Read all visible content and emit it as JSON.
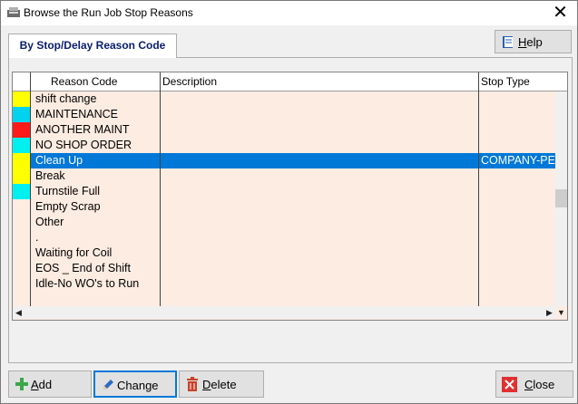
{
  "window": {
    "title": "Browse the Run Job Stop Reasons",
    "close_glyph": "✕"
  },
  "tab": {
    "label": "By Stop/Delay Reason Code"
  },
  "help": {
    "label_prefix": "H",
    "label_rest": "elp"
  },
  "table": {
    "columns": [
      "Reason Code",
      "Description",
      "Stop Type"
    ],
    "rows": [
      {
        "color": "#ffff00",
        "code": "shift change",
        "description": "",
        "stop_type": ""
      },
      {
        "color": "#00d2f0",
        "code": "MAINTENANCE",
        "description": "",
        "stop_type": ""
      },
      {
        "color": "#ff1a1a",
        "code": "ANOTHER MAINT",
        "description": "",
        "stop_type": ""
      },
      {
        "color": "#00f0f0",
        "code": "NO SHOP ORDER",
        "description": "",
        "stop_type": ""
      },
      {
        "color": "#ffff00",
        "code": "Clean Up",
        "description": "",
        "stop_type": "COMPANY-PE",
        "selected": true
      },
      {
        "color": "#ffff00",
        "code": "Break",
        "description": "",
        "stop_type": ""
      },
      {
        "color": "#00f0f0",
        "code": "Turnstile Full",
        "description": "",
        "stop_type": ""
      },
      {
        "color": "",
        "code": "Empty Scrap",
        "description": "",
        "stop_type": ""
      },
      {
        "color": "",
        "code": "Other",
        "description": "",
        "stop_type": ""
      },
      {
        "color": "",
        "code": ".",
        "description": "",
        "stop_type": ""
      },
      {
        "color": "",
        "code": "Waiting for Coil",
        "description": "",
        "stop_type": ""
      },
      {
        "color": "",
        "code": "EOS _ End of Shift",
        "description": "",
        "stop_type": ""
      },
      {
        "color": "",
        "code": "Idle-No WO's to Run",
        "description": "",
        "stop_type": ""
      }
    ]
  },
  "buttons": {
    "add": {
      "u": "A",
      "rest": "dd"
    },
    "change": {
      "u": "",
      "rest": "Change"
    },
    "delete": {
      "u": "D",
      "rest": "elete"
    },
    "close": {
      "u": "C",
      "rest": "lose"
    }
  },
  "colors": {
    "selection": "#0078d7",
    "grid_bg": "#fdece2"
  }
}
